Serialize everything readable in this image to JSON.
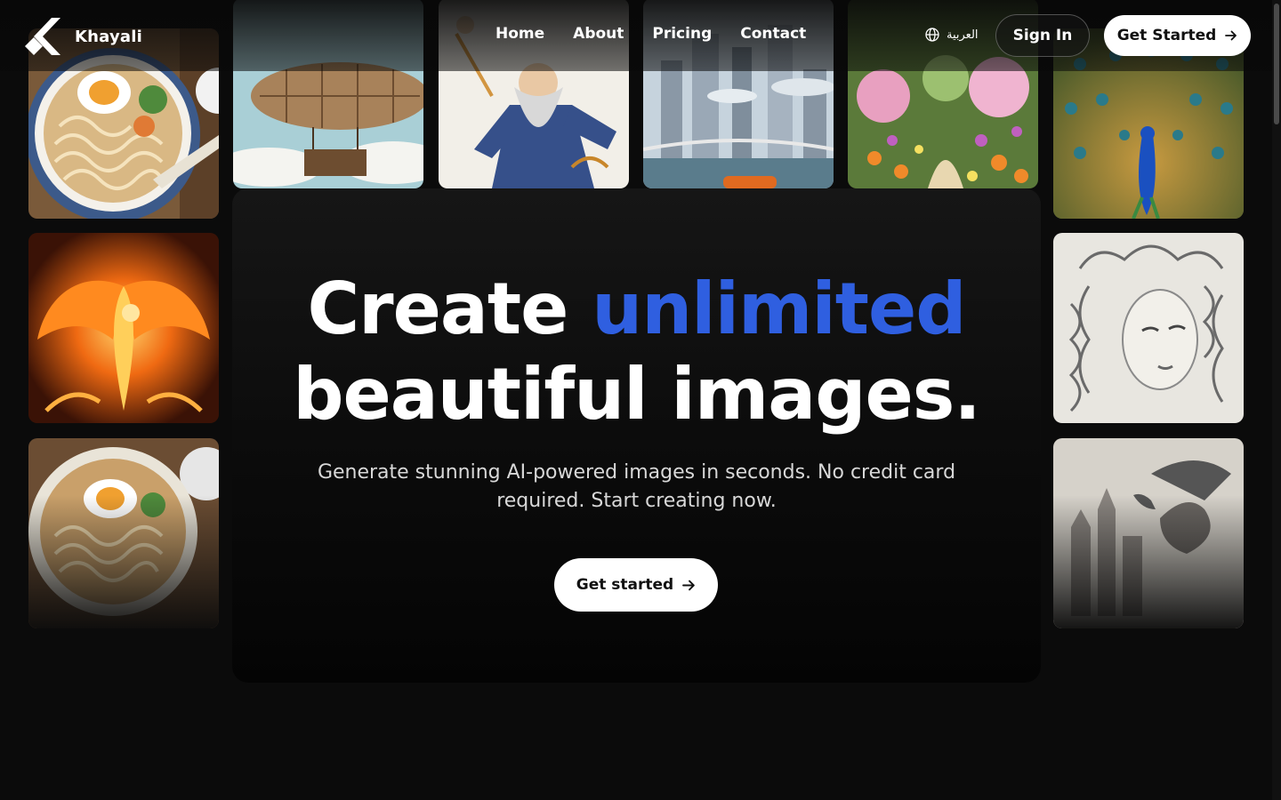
{
  "brand": {
    "name": "Khayali",
    "logo_icon": "chevron-left-logo-icon"
  },
  "nav": {
    "links": [
      "Home",
      "About",
      "Pricing",
      "Contact"
    ],
    "language_label": "العربية",
    "language_icon": "globe-icon",
    "signin_label": "Sign In",
    "get_started_label": "Get Started",
    "get_started_icon": "arrow-right-icon"
  },
  "hero": {
    "title_part1": "Create",
    "title_accent": "unlimited",
    "title_part2": "beautiful images.",
    "subtitle": "Generate stunning AI-powered images in seconds. No credit card required. Start creating now.",
    "cta_label": "Get started",
    "cta_icon": "arrow-right-icon",
    "accent_color": "#2f5fe0"
  },
  "gallery": {
    "tiles": [
      "ramen-bowl-image",
      "phoenix-fire-image",
      "ramen-bowl-image",
      "steampunk-airship-image",
      "wizard-image",
      "futuristic-city-image",
      "flower-garden-image",
      "peacock-image",
      "woman-sketch-image",
      "dragon-castle-sketch-image"
    ]
  }
}
